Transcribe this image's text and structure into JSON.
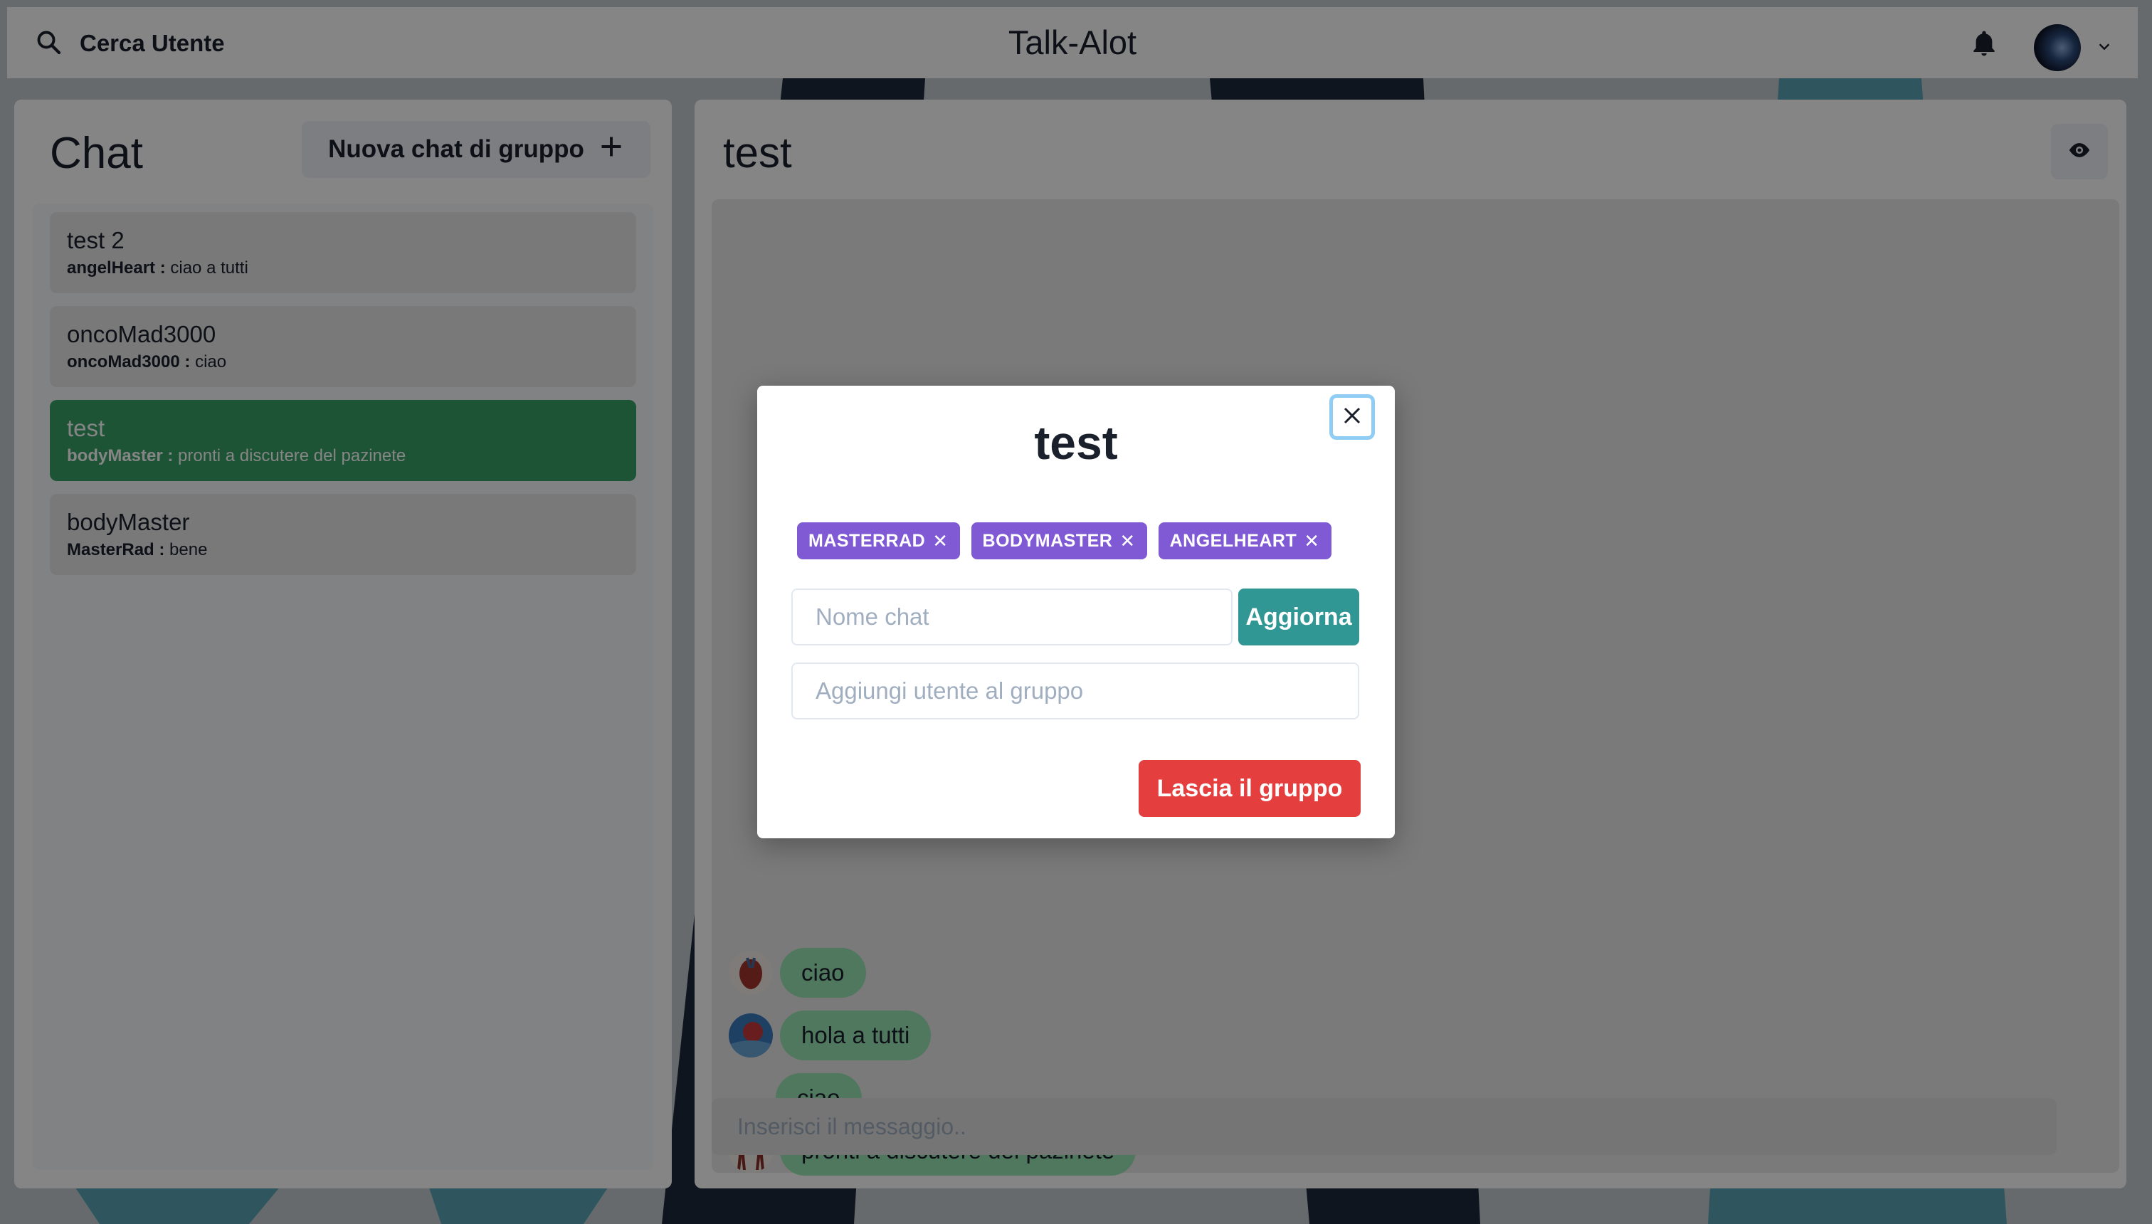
{
  "header": {
    "search_label": "Cerca Utente",
    "app_title": "Talk-Alot"
  },
  "sidebar": {
    "heading": "Chat",
    "new_group_label": "Nuova chat di gruppo",
    "chats": [
      {
        "name": "test 2",
        "sender": "angelHeart :",
        "message": "ciao a tutti",
        "active": false
      },
      {
        "name": "oncoMad3000",
        "sender": "oncoMad3000 :",
        "message": "ciao",
        "active": false
      },
      {
        "name": "test",
        "sender": "bodyMaster :",
        "message": "pronti a discutere del pazinete",
        "active": true
      },
      {
        "name": "bodyMaster",
        "sender": "MasterRad :",
        "message": "bene",
        "active": false
      }
    ]
  },
  "conversation": {
    "title": "test",
    "messages": [
      {
        "text": "ciao",
        "avatar": "heart-avatar"
      },
      {
        "text": "hola a tutti",
        "avatar": "globe-avatar"
      },
      {
        "text": "ciao",
        "avatar": ""
      },
      {
        "text": "pronti a discutere del pazinete",
        "avatar": "anatomy-avatar"
      }
    ],
    "input_placeholder": "Inserisci il messaggio.."
  },
  "modal": {
    "title": "test",
    "members": [
      "MASTERRAD",
      "BODYMASTER",
      "ANGELHEART"
    ],
    "chat_name_placeholder": "Nome chat",
    "update_label": "Aggiorna",
    "add_user_placeholder": "Aggiungi utente al gruppo",
    "leave_label": "Lascia il gruppo"
  },
  "colors": {
    "active_chat": "#38a169",
    "bubble": "#9ae6b4",
    "tag": "#805ad5",
    "update_button": "#319795",
    "leave_button": "#e53e3e"
  }
}
